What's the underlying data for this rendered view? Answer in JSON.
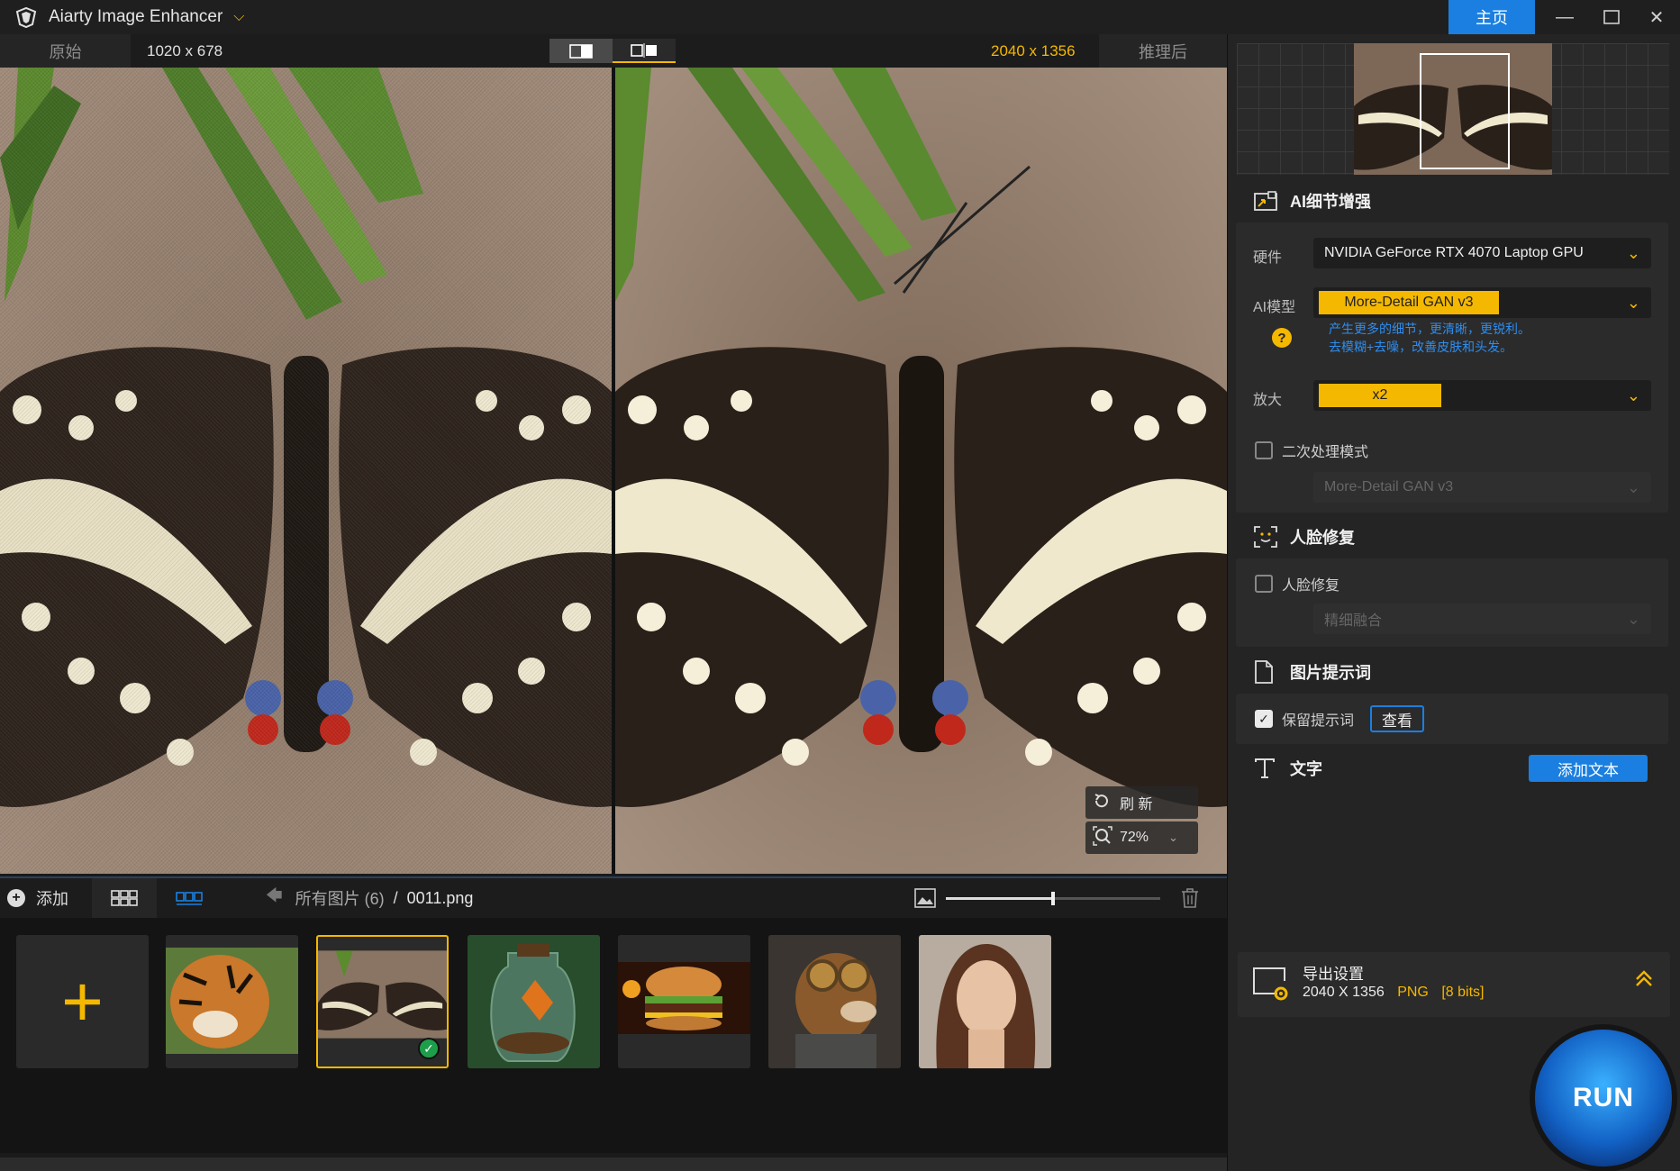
{
  "app": {
    "title": "Aiarty Image Enhancer",
    "home_label": "主页"
  },
  "compare": {
    "left_label": "原始",
    "left_resolution": "1020 x 678",
    "right_resolution": "2040 x 1356",
    "right_label": "推理后"
  },
  "overlay": {
    "refresh_label": "刷 新",
    "zoom_value": "72%"
  },
  "bottom_bar": {
    "add_label": "添加",
    "breadcrumb_root": "所有图片 (6)",
    "breadcrumb_sep": "/",
    "breadcrumb_file": "0011.png",
    "thumb_size_level": 0.5
  },
  "thumbnails": [
    {
      "name": "tiger",
      "selected": false
    },
    {
      "name": "butterfly",
      "selected": true
    },
    {
      "name": "terrarium-jar",
      "selected": false
    },
    {
      "name": "burger",
      "selected": false
    },
    {
      "name": "steampunk-dog",
      "selected": false
    },
    {
      "name": "woman-portrait",
      "selected": false
    }
  ],
  "panel": {
    "enhance_title": "AI细节增强",
    "hardware_label": "硬件",
    "hardware_value": "NVIDIA GeForce RTX 4070 Laptop GPU",
    "model_label": "AI模型",
    "model_value": "More-Detail GAN  v3",
    "model_desc_line1": "产生更多的细节，更清晰，更锐利。",
    "model_desc_line2": "去模糊+去噪，改善皮肤和头发。",
    "scale_label": "放大",
    "scale_value": "x2",
    "second_pass_label": "二次处理模式",
    "second_pass_model": "More-Detail GAN  v3",
    "face_title": "人脸修复",
    "face_checkbox_label": "人脸修复",
    "face_mode": "精细融合",
    "prompt_title": "图片提示词",
    "keep_prompt_label": "保留提示词",
    "view_label": "查看",
    "text_title": "文字",
    "add_text_label": "添加文本"
  },
  "export": {
    "title": "导出设置",
    "resolution": "2040 X 1356",
    "format": "PNG",
    "bits": "[8 bits]"
  },
  "run_label": "RUN",
  "colors": {
    "accent": "#f5b800",
    "primary": "#1a7fe0",
    "background": "#1a1a1a"
  }
}
